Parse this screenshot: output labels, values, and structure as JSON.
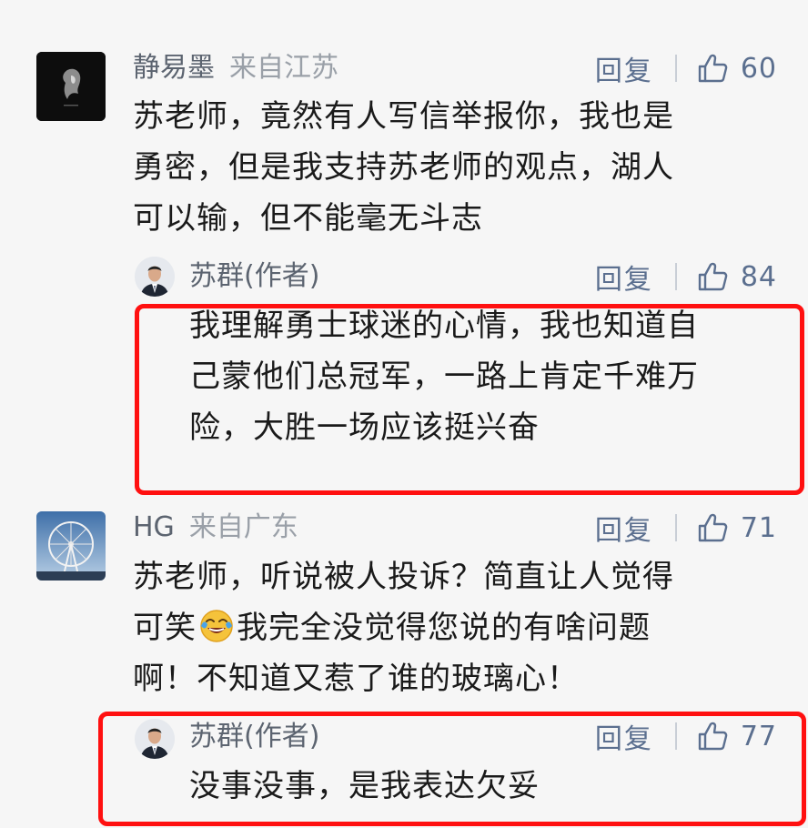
{
  "comments": [
    {
      "user": "静易墨",
      "location": "来自江苏",
      "reply_label": "回复",
      "likes": "60",
      "text": "苏老师，竟然有人写信举报你，我也是\n勇密，但是我支持苏老师的观点，湖人\n可以输，但不能毫无斗志",
      "avatar_icon": "dark-statue-avatar",
      "reply": {
        "user": "苏群(作者)",
        "reply_label": "回复",
        "likes": "84",
        "text": "我理解勇士球迷的心情，我也知道自\n己蒙他们总冠军，一路上肯定千难万\n险，大胜一场应该挺兴奋",
        "avatar_icon": "man-in-suit-avatar"
      }
    },
    {
      "user": "HG",
      "location": "来自广东",
      "reply_label": "回复",
      "likes": "71",
      "text_line1": "苏老师，听说被人投诉？简直让人觉得",
      "text_line2_before": "可笑",
      "emoji": "laughing-crying-emoji",
      "text_line2_after": "我完全没觉得您说的有啥问题",
      "text_line3": "啊！不知道又惹了谁的玻璃心！",
      "avatar_icon": "ferris-wheel-avatar",
      "reply": {
        "user": "苏群(作者)",
        "reply_label": "回复",
        "likes": "77",
        "text": "没事没事，是我表达欠妥",
        "avatar_icon": "man-in-suit-avatar"
      }
    }
  ],
  "colors": {
    "highlight_border": "#ff1010",
    "action_blue": "#5b6f8f",
    "name_gray": "#5c6470",
    "background": "#f6f6f6"
  }
}
